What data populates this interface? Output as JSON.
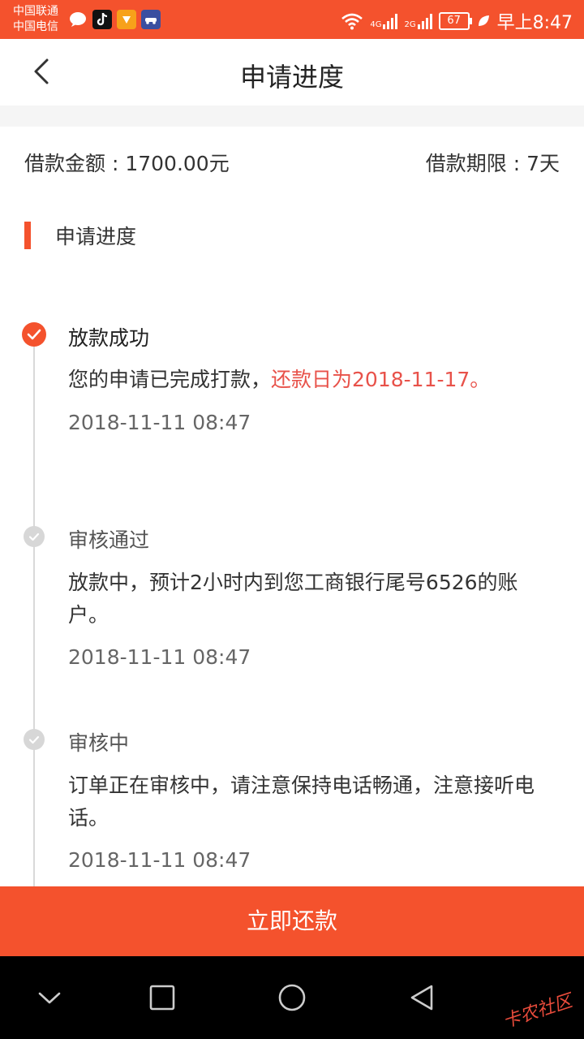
{
  "status_bar": {
    "carrier1": "中国联通",
    "carrier2": "中国电信",
    "net1": "4G",
    "net2": "2G",
    "battery": "67",
    "time": "早上8:47"
  },
  "header": {
    "title": "申请进度"
  },
  "summary": {
    "amount": "借款金额 : 1700.00元",
    "term": "借款期限 : 7天"
  },
  "section": {
    "title": "申请进度"
  },
  "timeline": [
    {
      "title": "放款成功",
      "desc": "您的申请已完成打款，",
      "desc_highlight": "还款日为2018-11-17。",
      "time": "2018-11-11 08:47"
    },
    {
      "title": "审核通过",
      "desc": "放款中，预计2小时内到您工商银行尾号6526的账户。",
      "time": "2018-11-11 08:47"
    },
    {
      "title": "审核中",
      "desc": "订单正在审核中，请注意保持电话畅通，注意接听电话。",
      "time": "2018-11-11 08:47"
    }
  ],
  "button": {
    "repay": "立即还款"
  },
  "watermark": "卡农社区",
  "colors": {
    "accent": "#f4522d",
    "highlight": "#e8524a",
    "inactive": "#d7d7d7"
  }
}
